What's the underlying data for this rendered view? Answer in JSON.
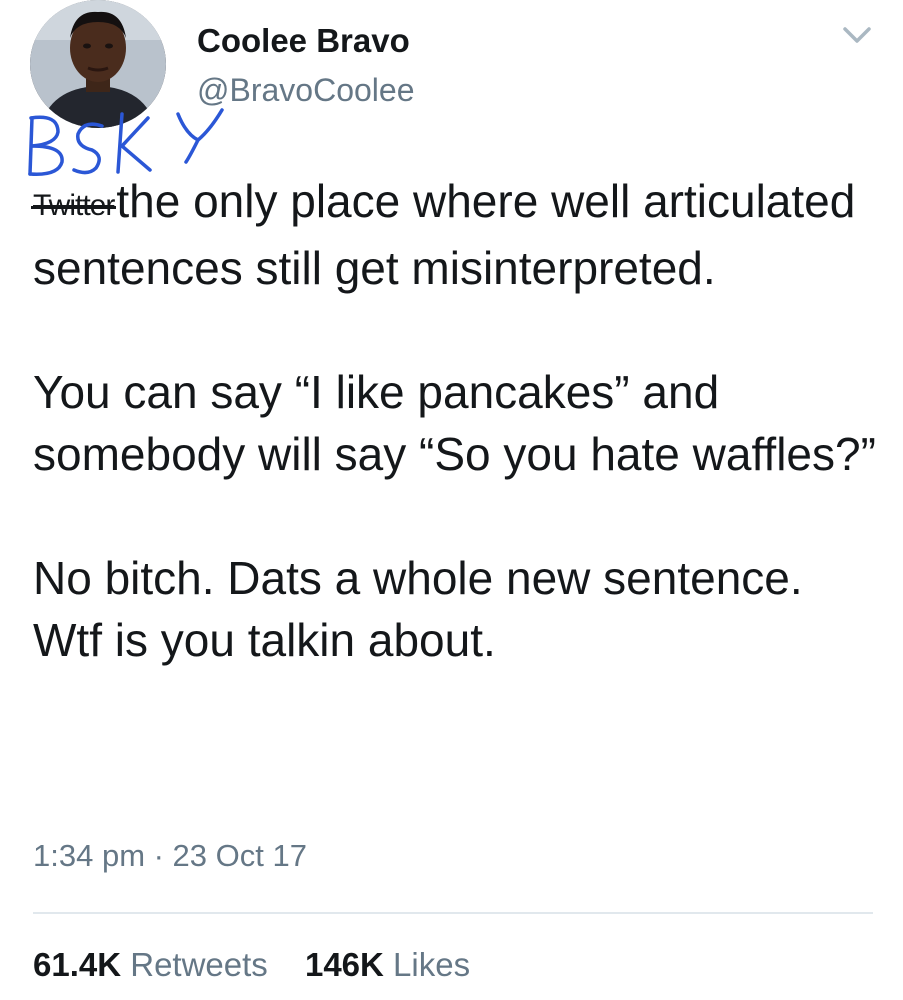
{
  "user": {
    "display_name": "Coolee Bravo",
    "handle": "@BravoCoolee"
  },
  "annotation": {
    "scrawl_text": "BSKY",
    "scrawl_color": "#2b57d6"
  },
  "tweet": {
    "struck_word": "Twitter",
    "paragraphs": [
      "the only place where well articulated sentences still get misinterpreted.",
      "You can say “I like pancakes” and somebody will say “So you hate waffles?”",
      "No bitch. Dats a whole new sentence. Wtf is you talkin about."
    ],
    "timestamp": "1:34 pm · 23 Oct 17"
  },
  "stats": {
    "retweets_count": "61.4K",
    "retweets_label": "Retweets",
    "likes_count": "146K",
    "likes_label": "Likes"
  },
  "icons": {
    "menu": "chevron-down-icon"
  },
  "colors": {
    "text": "#14171a",
    "secondary": "#657786",
    "divider": "#e1e8ed"
  }
}
